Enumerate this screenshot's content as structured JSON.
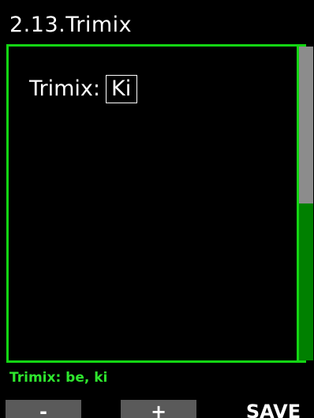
{
  "screen": {
    "title": "2.13.Trimix"
  },
  "setting": {
    "label": "Trimix:",
    "value": "Ki"
  },
  "scrollbar": {
    "position_fraction": 0.5
  },
  "status_line": "Trimix: be, ki",
  "softkeys": {
    "left": "-",
    "middle": "+",
    "right": "SAVE"
  },
  "colors": {
    "frame": "#13d613",
    "status_text": "#2ee62e",
    "scroll_track": "#008000",
    "scroll_thumb": "#8c8c8c",
    "softkey_bg": "#5a5a5a"
  }
}
